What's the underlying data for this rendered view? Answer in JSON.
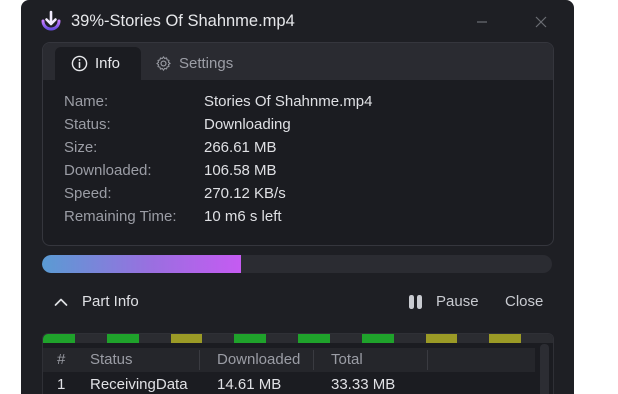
{
  "window": {
    "title": "39%-Stories Of Shahnme.mp4",
    "colors": {
      "background": "#1e1f24",
      "accent_start": "#5a9bd3",
      "accent_end": "#c55bf2"
    }
  },
  "tabs": {
    "info_label": "Info",
    "settings_label": "Settings"
  },
  "info": [
    {
      "label": "Name:",
      "value": "Stories Of Shahnme.mp4"
    },
    {
      "label": "Status:",
      "value": "Downloading"
    },
    {
      "label": "Size:",
      "value": "266.61 MB"
    },
    {
      "label": "Downloaded:",
      "value": "106.58 MB"
    },
    {
      "label": "Speed:",
      "value": "270.12 KB/s"
    },
    {
      "label": "Remaining Time:",
      "value": "10 m6 s left"
    }
  ],
  "progress": {
    "fraction": 0.39
  },
  "part_info": {
    "toggle_label": "Part Info",
    "pause_label": "Pause",
    "close_label": "Close",
    "segments": [
      "green",
      "dark",
      "green",
      "dark",
      "olive",
      "dark",
      "green",
      "dark",
      "green",
      "dark",
      "green",
      "dark",
      "olive",
      "dark",
      "olive",
      "dark"
    ],
    "segment_colors": {
      "green": "#1fa22b",
      "olive": "#9b9a26",
      "dark": "#2b2c31"
    },
    "columns": [
      "#",
      "Status",
      "Downloaded",
      "Total"
    ],
    "rows": [
      {
        "index": "1",
        "status": "ReceivingData",
        "downloaded": "14.61 MB",
        "total": "33.33 MB"
      }
    ]
  }
}
